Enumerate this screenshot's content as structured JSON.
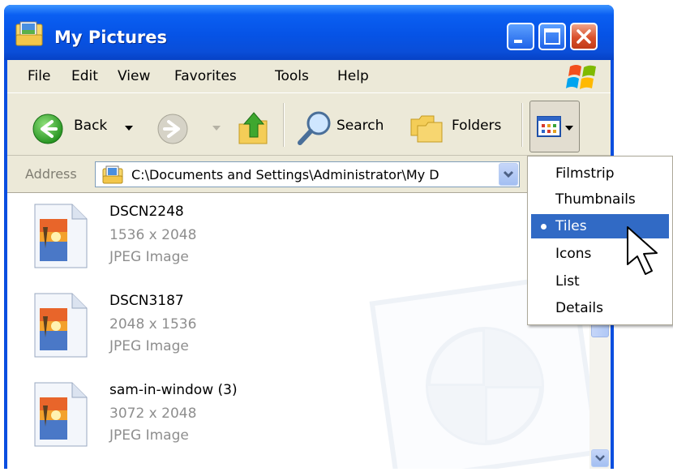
{
  "window": {
    "title": "My Pictures"
  },
  "menubar": {
    "items": [
      "File",
      "Edit",
      "View",
      "Favorites",
      "Tools",
      "Help"
    ]
  },
  "toolbar": {
    "back_label": "Back",
    "search_label": "Search",
    "folders_label": "Folders"
  },
  "address": {
    "label": "Address",
    "value": "C:\\Documents and Settings\\Administrator\\My D"
  },
  "files": [
    {
      "name": "DSCN2248",
      "dimensions": "1536 x 2048",
      "type": "JPEG Image"
    },
    {
      "name": "DSCN3187",
      "dimensions": "2048 x 1536",
      "type": "JPEG Image"
    },
    {
      "name": "sam-in-window (3)",
      "dimensions": "3072 x 2048",
      "type": "JPEG Image"
    }
  ],
  "views_menu": {
    "items": [
      "Filmstrip",
      "Thumbnails",
      "Tiles",
      "Icons",
      "List",
      "Details"
    ],
    "selected": "Tiles"
  },
  "colors": {
    "titlebar": "#0a5ff2",
    "selection": "#316ac5",
    "chrome": "#ece9d8"
  }
}
